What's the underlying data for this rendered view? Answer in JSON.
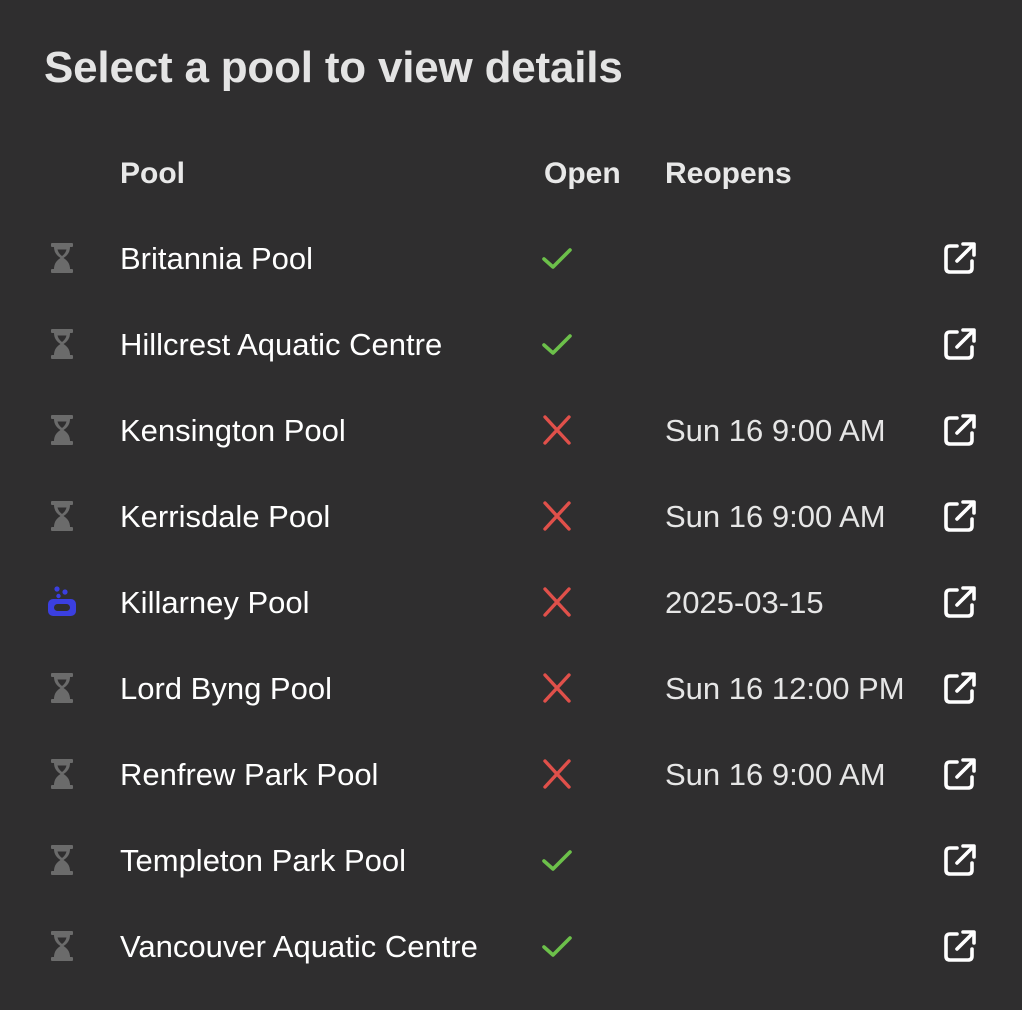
{
  "title": "Select a pool to view details",
  "columns": {
    "pool": "Pool",
    "open": "Open",
    "reopens": "Reopens"
  },
  "colors": {
    "background": "#2f2e2f",
    "open_check": "#6cc04a",
    "closed_x": "#e0504a",
    "hourglass": "#6b6b6b",
    "swim_icon": "#3b3fe0"
  },
  "pools": [
    {
      "name": "Britannia Pool",
      "open": true,
      "reopens": "",
      "status_icon": "hourglass-icon"
    },
    {
      "name": "Hillcrest Aquatic Centre",
      "open": true,
      "reopens": "",
      "status_icon": "hourglass-icon"
    },
    {
      "name": "Kensington Pool",
      "open": false,
      "reopens": "Sun 16 9:00 AM",
      "status_icon": "hourglass-icon"
    },
    {
      "name": "Kerrisdale Pool",
      "open": false,
      "reopens": "Sun 16 9:00 AM",
      "status_icon": "hourglass-icon"
    },
    {
      "name": "Killarney Pool",
      "open": false,
      "reopens": "2025-03-15",
      "status_icon": "swimming-pool-icon"
    },
    {
      "name": "Lord Byng Pool",
      "open": false,
      "reopens": "Sun 16 12:00 PM",
      "status_icon": "hourglass-icon"
    },
    {
      "name": "Renfrew Park Pool",
      "open": false,
      "reopens": "Sun 16 9:00 AM",
      "status_icon": "hourglass-icon"
    },
    {
      "name": "Templeton Park Pool",
      "open": true,
      "reopens": "",
      "status_icon": "hourglass-icon"
    },
    {
      "name": "Vancouver Aquatic Centre",
      "open": true,
      "reopens": "",
      "status_icon": "hourglass-icon"
    }
  ],
  "row_action_icon": "external-link-icon"
}
